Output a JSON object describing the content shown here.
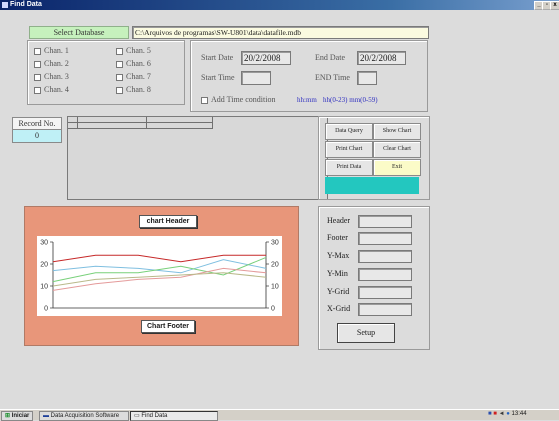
{
  "window": {
    "title": "Find Data",
    "min": "_",
    "max": "▫",
    "close": "x"
  },
  "top": {
    "select_db_label": "Select Database",
    "db_path": "C:\\Arquivos de programas\\SW-U801\\data\\datafile.mdb"
  },
  "channels": [
    "Chan. 1",
    "Chan. 2",
    "Chan. 3",
    "Chan. 4",
    "Chan. 5",
    "Chan. 6",
    "Chan. 7",
    "Chan. 8"
  ],
  "datetime": {
    "start_date_label": "Start Date",
    "start_date_value": "20/2/2008",
    "end_date_label": "End Date",
    "end_date_value": "20/2/2008",
    "start_time_label": "Start Time",
    "end_time_label": "END Time",
    "add_time_label": "Add Time condition",
    "hint_hhmm": "hh:mm",
    "hint_range": "hh(0-23) mm(0-59)"
  },
  "record": {
    "label": "Record No.",
    "value": "0"
  },
  "actions": {
    "data_query": "Data Query",
    "show_chart": "Show Chart",
    "print_chart": "Print Chart",
    "clear_chart": "Clear Chart",
    "print_data": "Print Data",
    "exit": "Exit",
    "status_text": "",
    "status_color": "#23c7bf"
  },
  "chart": {
    "header_btn": "chart Header",
    "footer_btn": "Chart Footer",
    "bg_color": "#e8967a"
  },
  "chart_data": {
    "type": "line",
    "x": [
      1,
      2,
      3,
      4,
      5,
      6
    ],
    "ylim": [
      0,
      30
    ],
    "yticks": [
      "0",
      "10",
      "20",
      "30"
    ],
    "series": [
      {
        "color": "#c62828",
        "values": [
          21,
          24,
          24,
          21,
          24,
          24
        ]
      },
      {
        "color": "#7fbfe0",
        "values": [
          17,
          19,
          18,
          16,
          22,
          18
        ]
      },
      {
        "color": "#78d07a",
        "values": [
          12,
          16,
          16,
          19,
          15,
          23
        ]
      },
      {
        "color": "#e49a9a",
        "values": [
          8,
          11,
          13,
          14,
          18,
          16
        ]
      },
      {
        "color": "#b9b98a",
        "values": [
          10,
          13,
          14,
          15,
          16,
          14
        ]
      }
    ]
  },
  "settings": {
    "header": "Header",
    "footer": "Footer",
    "ymax": "Y-Max",
    "ymin": "Y-Min",
    "ygrid": "Y-Grid",
    "xgrid": "X-Grid",
    "setup": "Setup"
  },
  "taskbar": {
    "start": "Iniciar",
    "app1": "Data Acquisition Software",
    "app2": "Find Data",
    "clock": "13:44"
  }
}
